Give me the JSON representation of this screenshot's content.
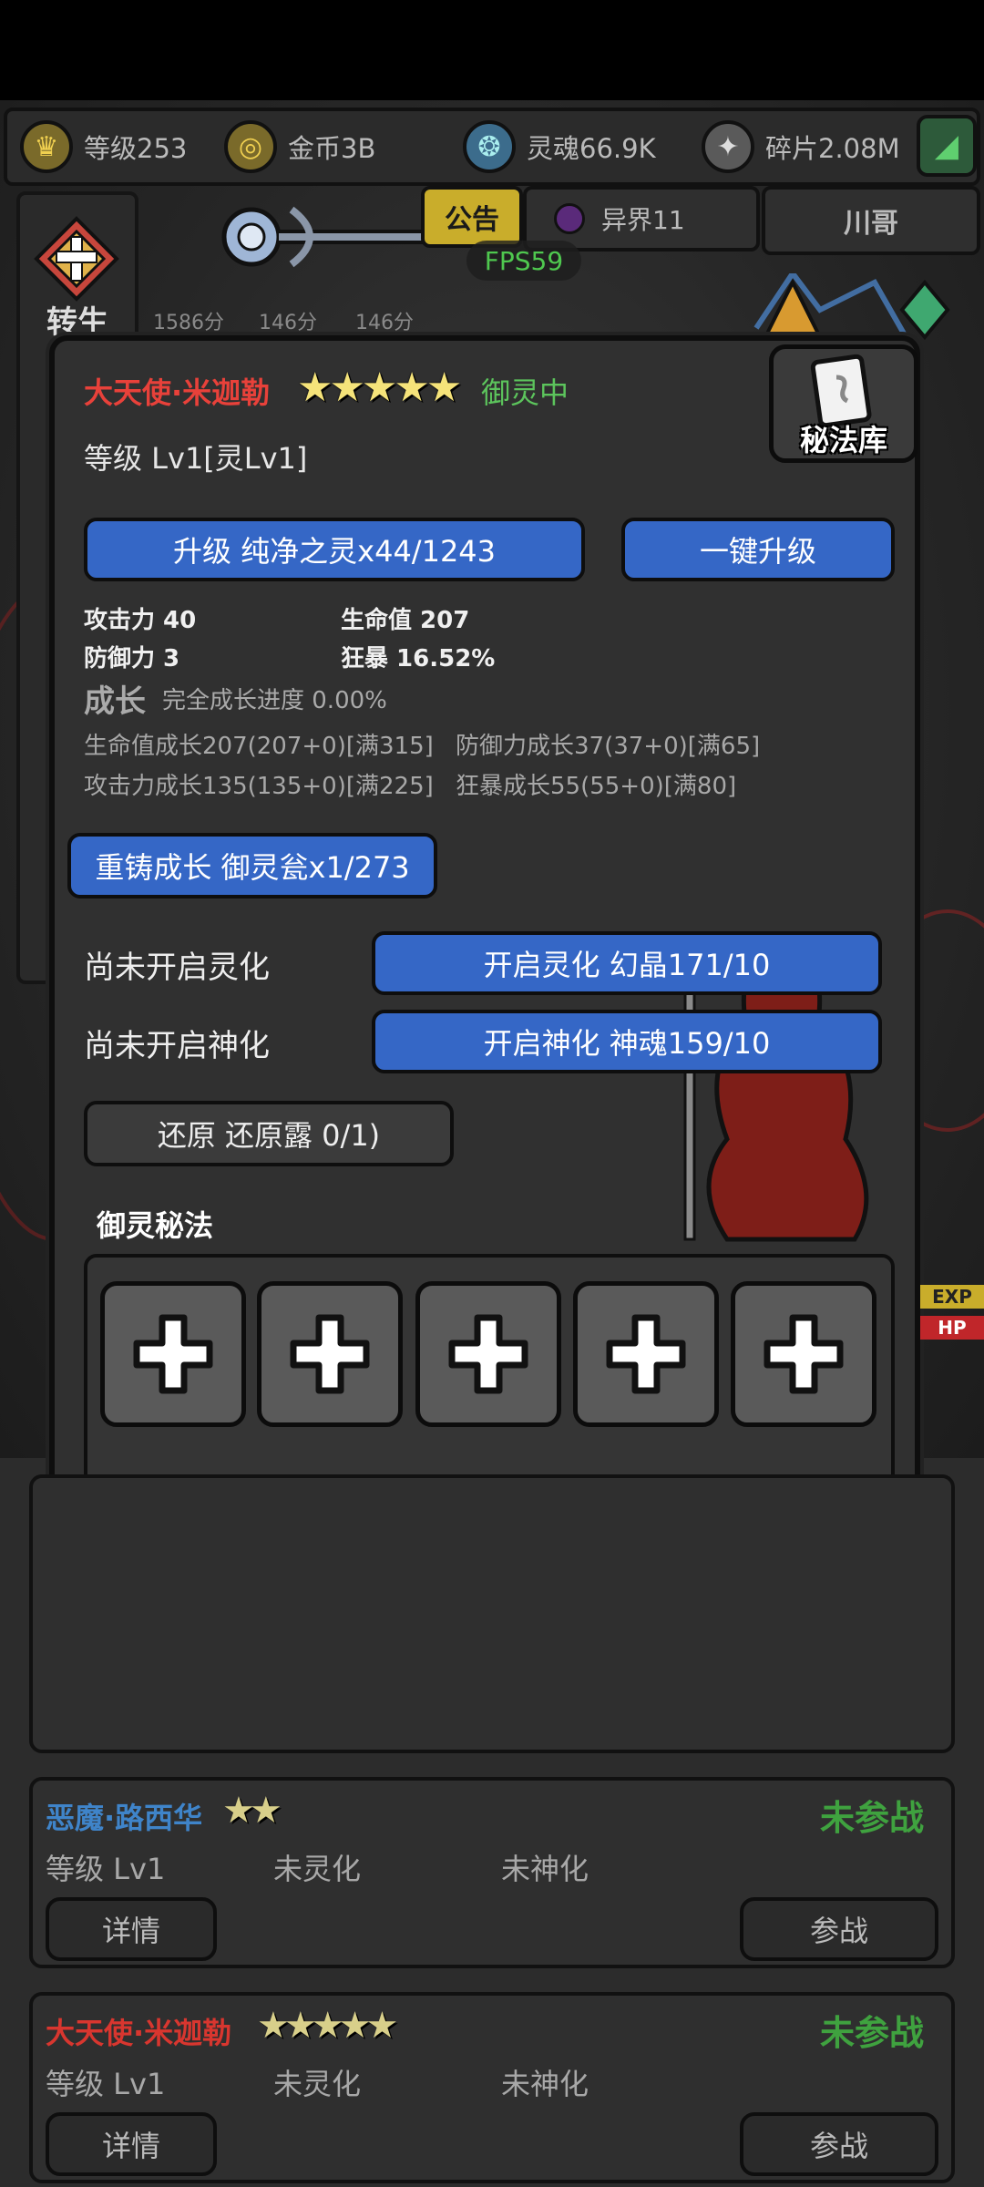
{
  "resources": [
    {
      "icon": "crown-icon",
      "label": "等级253"
    },
    {
      "icon": "coin-icon",
      "label": "金币3B"
    },
    {
      "icon": "soul-icon",
      "label": "灵魂66.9K"
    },
    {
      "icon": "shard-icon",
      "label": "碎片2.08M"
    }
  ],
  "tabs": {
    "notice": "公告",
    "realm": "异界11",
    "user": "川哥"
  },
  "fps": "FPS59",
  "side": {
    "rebirth": "转生"
  },
  "timers": [
    "1586分",
    "146分",
    "146分"
  ],
  "modal": {
    "name": "大天使·米迦勒",
    "stars": 5,
    "status": "御灵中",
    "library_label": "秘法库",
    "level": "等级 Lv1[灵Lv1]",
    "upgrade_btn": "升级 纯净之灵x44/1243",
    "oneclick_btn": "一键升级",
    "stats": {
      "atk": "攻击力 40",
      "hp": "生命值 207",
      "def": "防御力 3",
      "crit": "狂暴 16.52%"
    },
    "growth_title": "成长",
    "growth_progress": "完全成长进度 0.00%",
    "growth_lines": [
      "生命值成长207(207+0)[满315]",
      "防御力成长37(37+0)[满65]",
      "攻击力成长135(135+0)[满225]",
      "狂暴成长55(55+0)[满80]"
    ],
    "reforge_btn": "重铸成长 御灵瓮x1/273",
    "spirit_label": "尚未开启灵化",
    "spirit_btn": "开启灵化 幻晶171/10",
    "god_label": "尚未开启神化",
    "god_btn": "开启神化 神魂159/10",
    "restore_btn": "还原 还原露 0/1)",
    "secret_title": "御灵秘法"
  },
  "cards": [
    {
      "name": "恶魔·路西华",
      "name_color": "#3f84c9",
      "stars": 2,
      "status": "未参战",
      "level": "等级 Lv1",
      "spirit": "未灵化",
      "god": "未神化",
      "detail_btn": "详情",
      "join_btn": "参战"
    },
    {
      "name": "大天使·米迦勒",
      "name_color": "#d8362f",
      "stars": 5,
      "status": "未参战",
      "level": "等级 Lv1",
      "spirit": "未灵化",
      "god": "未神化",
      "detail_btn": "详情",
      "join_btn": "参战"
    }
  ],
  "bg_labels": {
    "exp": "EXP",
    "hp": "HP"
  }
}
